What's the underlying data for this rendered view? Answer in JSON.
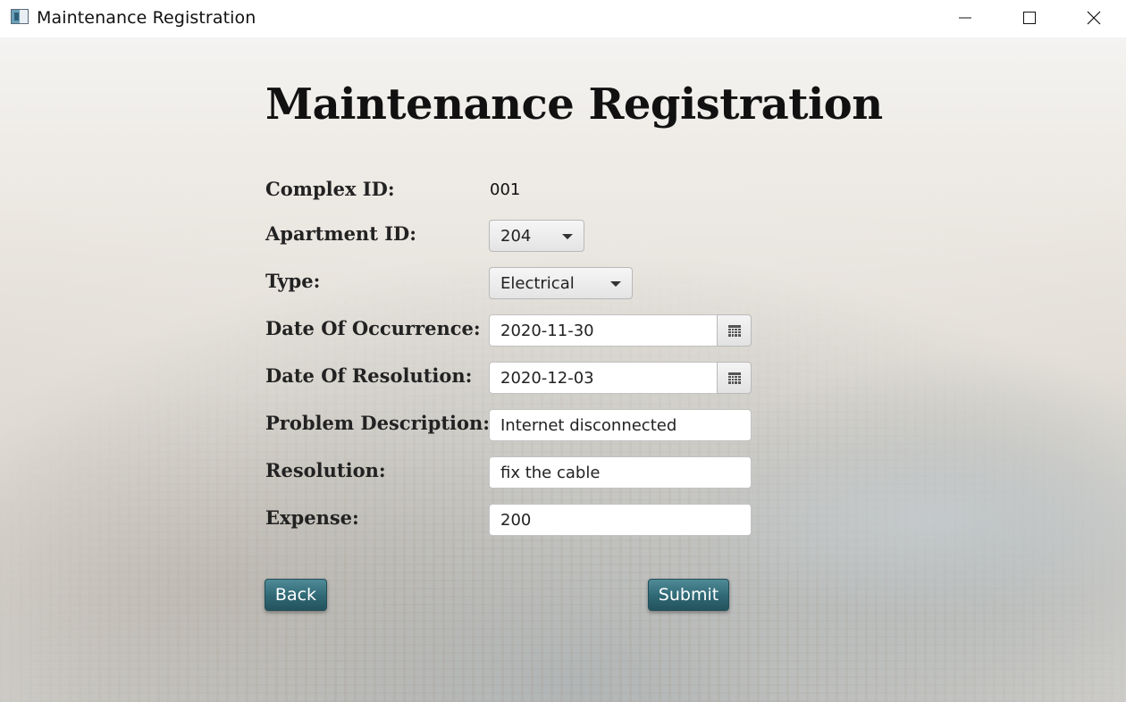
{
  "window": {
    "title": "Maintenance Registration",
    "controls": {
      "minimize_icon": "minimize-icon",
      "maximize_icon": "maximize-icon",
      "close_icon": "close-icon"
    }
  },
  "form": {
    "heading": "Maintenance Registration",
    "complex_id": {
      "label": "Complex ID:",
      "value": "001"
    },
    "apartment_id": {
      "label": "Apartment ID:",
      "selected": "204"
    },
    "type": {
      "label": "Type:",
      "selected": "Electrical"
    },
    "date_of_occurrence": {
      "label": "Date Of Occurrence:",
      "value": "2020-11-30",
      "icon": "calendar-icon"
    },
    "date_of_resolution": {
      "label": "Date Of Resolution:",
      "value": "2020-12-03",
      "icon": "calendar-icon"
    },
    "problem_description": {
      "label": "Problem Description:",
      "value": "Internet disconnected"
    },
    "resolution": {
      "label": "Resolution:",
      "value": "fix the cable"
    },
    "expense": {
      "label": "Expense:",
      "value": "200"
    }
  },
  "actions": {
    "back_label": "Back",
    "submit_label": "Submit"
  },
  "colors": {
    "button_top": "#4f8a97",
    "button_bottom": "#24535d",
    "title_text": "#111111"
  }
}
